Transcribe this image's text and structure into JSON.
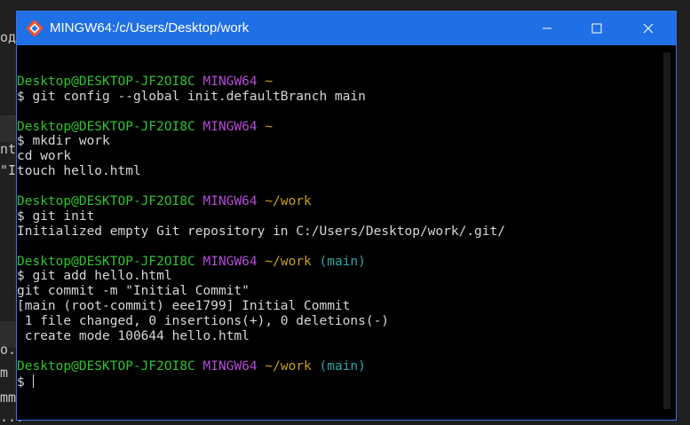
{
  "window": {
    "title": "MINGW64:/c/Users/Desktop/work",
    "title_bar_color": "#1f6fe5",
    "icons": {
      "app": "git-bash-icon",
      "minimize": "minimize-icon",
      "maximize": "maximize-icon",
      "close": "close-icon"
    }
  },
  "background_fragments": [
    "од",
    "nt",
    "\"I",
    "o.",
    "m",
    "mm",
    "... "
  ],
  "colors": {
    "user": "#2ec22e",
    "system": "#b54bd6",
    "path": "#c8a21a",
    "branch": "#2aa7a7",
    "output": "#d6d6d6"
  },
  "terminal": {
    "lines": [
      {
        "type": "blank"
      },
      {
        "type": "prompt",
        "user": "Desktop@DESKTOP-JF2OI8C",
        "system": "MINGW64",
        "path": "~",
        "branch": ""
      },
      {
        "type": "text",
        "text": "$ git config --global init.defaultBranch main"
      },
      {
        "type": "blank"
      },
      {
        "type": "prompt",
        "user": "Desktop@DESKTOP-JF2OI8C",
        "system": "MINGW64",
        "path": "~",
        "branch": ""
      },
      {
        "type": "text",
        "text": "$ mkdir work"
      },
      {
        "type": "text",
        "text": "cd work"
      },
      {
        "type": "text",
        "text": "touch hello.html"
      },
      {
        "type": "blank"
      },
      {
        "type": "prompt",
        "user": "Desktop@DESKTOP-JF2OI8C",
        "system": "MINGW64",
        "path": "~/work",
        "branch": ""
      },
      {
        "type": "text",
        "text": "$ git init"
      },
      {
        "type": "text",
        "text": "Initialized empty Git repository in C:/Users/Desktop/work/.git/"
      },
      {
        "type": "blank"
      },
      {
        "type": "prompt",
        "user": "Desktop@DESKTOP-JF2OI8C",
        "system": "MINGW64",
        "path": "~/work",
        "branch": "(main)"
      },
      {
        "type": "text",
        "text": "$ git add hello.html"
      },
      {
        "type": "text",
        "text": "git commit -m \"Initial Commit\""
      },
      {
        "type": "text",
        "text": "[main (root-commit) eee1799] Initial Commit"
      },
      {
        "type": "text",
        "text": " 1 file changed, 0 insertions(+), 0 deletions(-)"
      },
      {
        "type": "text",
        "text": " create mode 100644 hello.html"
      },
      {
        "type": "blank"
      },
      {
        "type": "prompt",
        "user": "Desktop@DESKTOP-JF2OI8C",
        "system": "MINGW64",
        "path": "~/work",
        "branch": "(main)"
      },
      {
        "type": "input",
        "text": "$ "
      }
    ]
  }
}
